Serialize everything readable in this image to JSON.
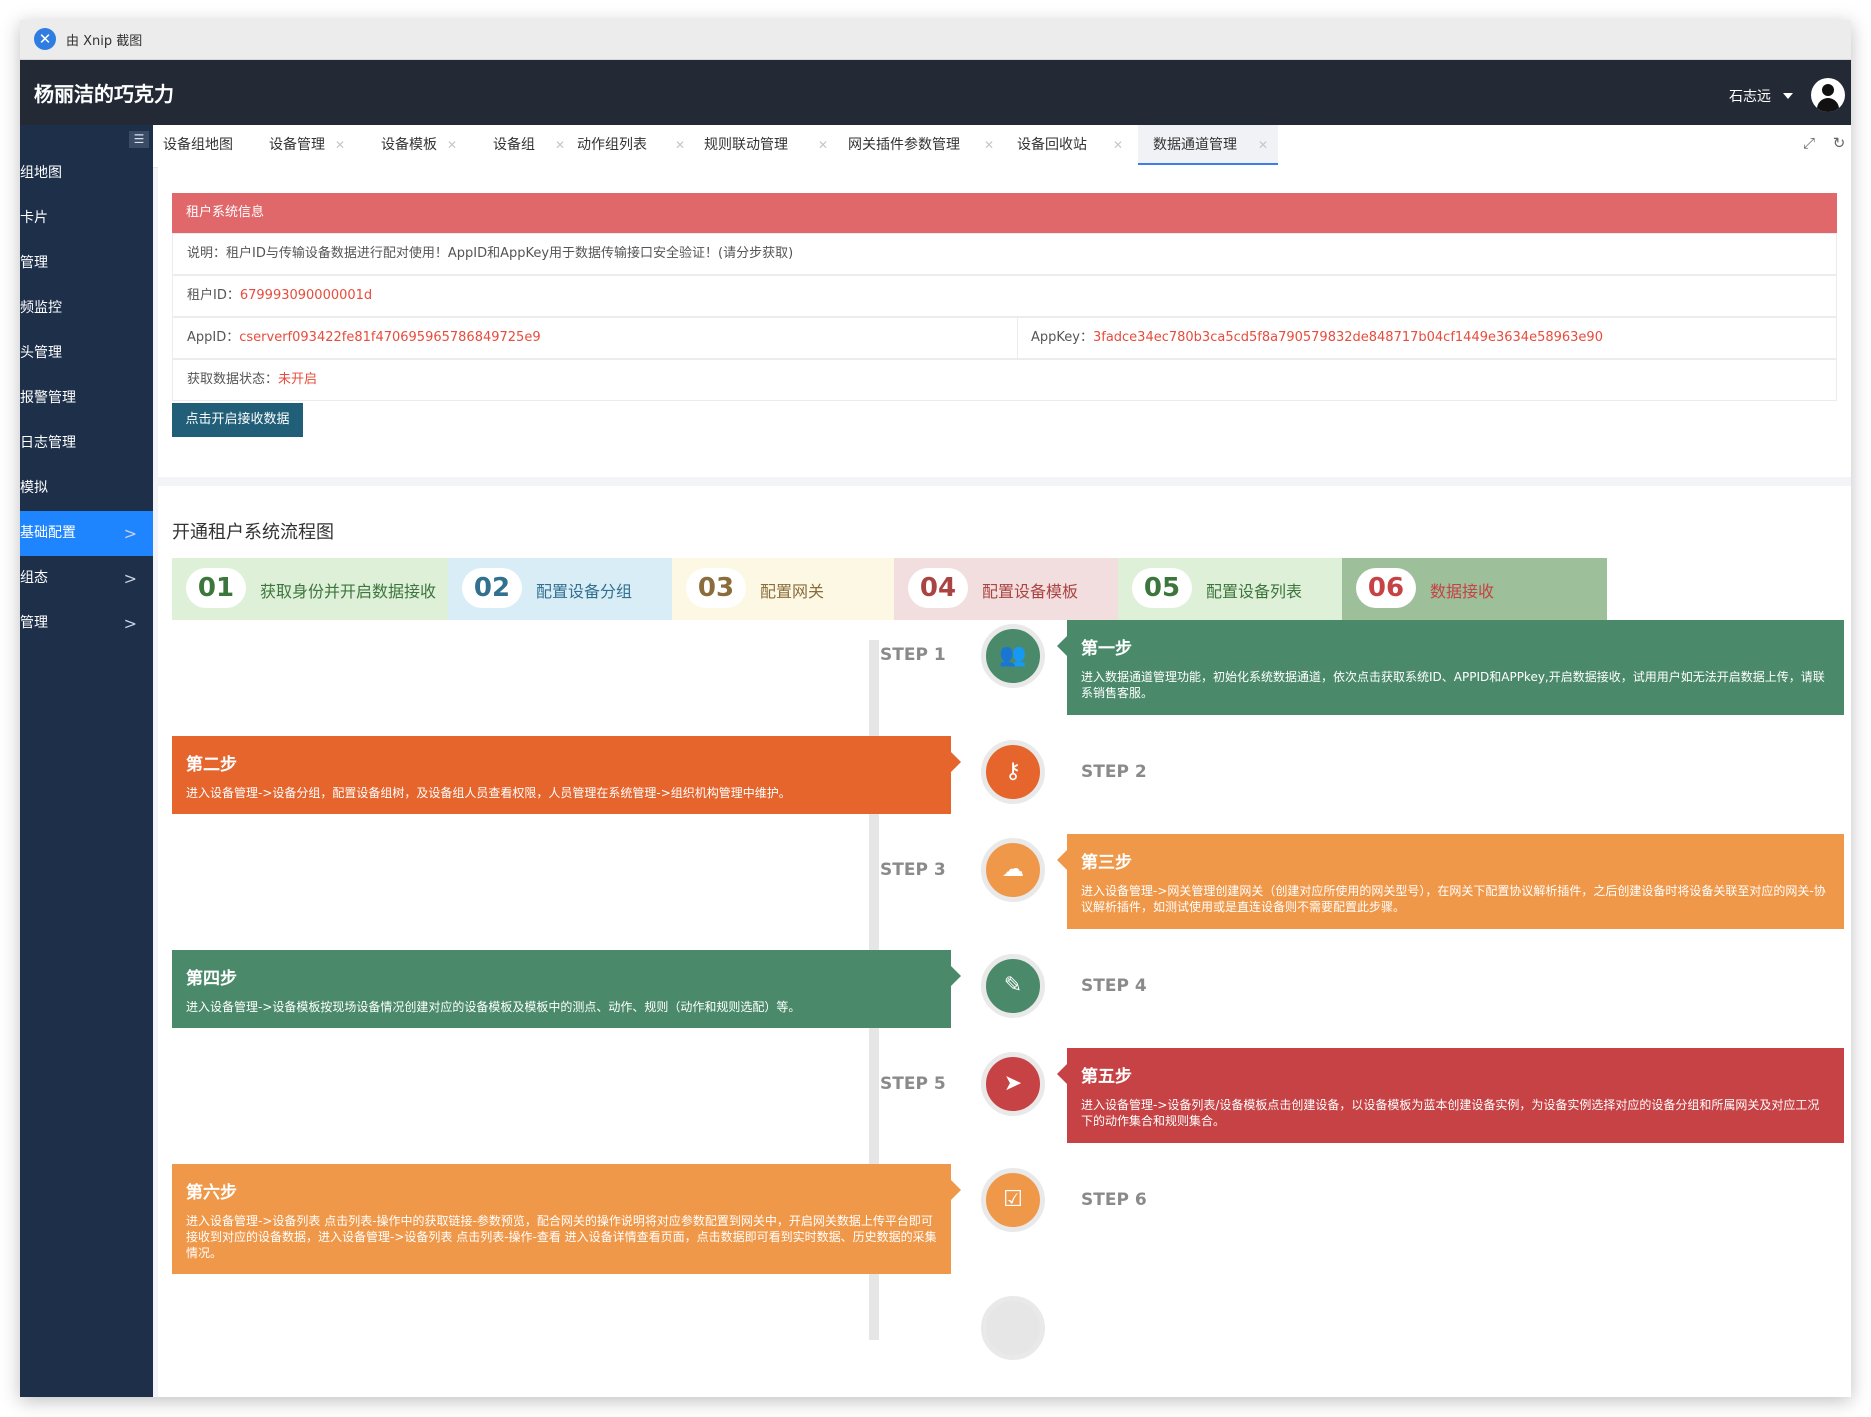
{
  "xnip": {
    "label": "由 Xnip 截图"
  },
  "header": {
    "brand": "杨丽洁的巧克力",
    "user": "石志远"
  },
  "sidebar": {
    "items": [
      {
        "label": "组地图",
        "arrow": ""
      },
      {
        "label": "卡片",
        "arrow": ""
      },
      {
        "label": "管理",
        "arrow": ""
      },
      {
        "label": "频监控",
        "arrow": ""
      },
      {
        "label": "头管理",
        "arrow": ""
      },
      {
        "label": "报警管理",
        "arrow": ""
      },
      {
        "label": "日志管理",
        "arrow": ""
      },
      {
        "label": "模拟",
        "arrow": ""
      },
      {
        "label": "基础配置",
        "arrow": ">"
      },
      {
        "label": "组态",
        "arrow": ">"
      },
      {
        "label": "管理",
        "arrow": ">"
      }
    ]
  },
  "tabs": [
    {
      "label": "设备组地图"
    },
    {
      "label": "设备管理"
    },
    {
      "label": "设备模板"
    },
    {
      "label": "设备组"
    },
    {
      "label": "动作组列表"
    },
    {
      "label": "规则联动管理"
    },
    {
      "label": "网关插件参数管理"
    },
    {
      "label": "设备回收站"
    },
    {
      "label": "数据通道管理"
    }
  ],
  "tenant": {
    "title": "租户系统信息",
    "desc": "说明：租户ID与传输设备数据进行配对使用！AppID和AppKey用于数据传输接口安全验证！(请分步获取)",
    "id_label": "租户ID：",
    "id_value": "679993090000001d",
    "appid_label": "AppID：",
    "appid_value": "cserverf093422fe81f470695965786849725e9",
    "appkey_label": "AppKey：",
    "appkey_value": "3fadce34ec780b3ca5cd5f8a790579832de848717b04cf1449e3634e58963e90",
    "status_label": "获取数据状态：",
    "status_value": "未开启",
    "button": "点击开启接收数据"
  },
  "flow": {
    "title": "开通租户系统流程图",
    "steps": [
      {
        "num": "01",
        "label": "获取身份并开启数据接收"
      },
      {
        "num": "02",
        "label": "配置设备分组"
      },
      {
        "num": "03",
        "label": "配置网关"
      },
      {
        "num": "04",
        "label": "配置设备模板"
      },
      {
        "num": "05",
        "label": "配置设备列表"
      },
      {
        "num": "06",
        "label": "数据接收"
      }
    ],
    "timeline": [
      {
        "step": "STEP 1",
        "title": "第一步",
        "desc": "进入数据通道管理功能，初始化系统数据通道，依次点击获取系统ID、APPID和APPkey,开启数据接收，试用用户如无法开启数据上传，请联系销售客服。"
      },
      {
        "step": "STEP 2",
        "title": "第二步",
        "desc": "进入设备管理->设备分组，配置设备组树，及设备组人员查看权限，人员管理在系统管理->组织机构管理中维护。"
      },
      {
        "step": "STEP 3",
        "title": "第三步",
        "desc": "进入设备管理->网关管理创建网关（创建对应所使用的网关型号），在网关下配置协议解析插件，之后创建设备时将设备关联至对应的网关-协议解析插件，如测试使用或是直连设备则不需要配置此步骤。"
      },
      {
        "step": "STEP 4",
        "title": "第四步",
        "desc": "进入设备管理->设备模板按现场设备情况创建对应的设备模板及模板中的测点、动作、规则（动作和规则选配）等。"
      },
      {
        "step": "STEP 5",
        "title": "第五步",
        "desc": "进入设备管理->设备列表/设备模板点击创建设备，以设备模板为蓝本创建设备实例，为设备实例选择对应的设备分组和所属网关及对应工况下的动作集合和规则集合。"
      },
      {
        "step": "STEP 6",
        "title": "第六步",
        "desc": "进入设备管理->设备列表 点击列表-操作中的获取链接-参数预览，配合网关的操作说明将对应参数配置到网关中，开启网关数据上传平台即可接收到对应的设备数据，进入设备管理->设备列表 点击列表-操作-查看 进入设备详情查看页面，点击数据即可看到实时数据、历史数据的采集情况。"
      }
    ]
  },
  "colors": {
    "green": "#4a8a6a",
    "orange_dark": "#e5652d",
    "orange": "#f0984a",
    "red": "#c64244"
  },
  "icons": [
    "users-icon",
    "key-icon",
    "cloud-icon",
    "pencil-icon",
    "send-icon",
    "clipboard-icon"
  ]
}
